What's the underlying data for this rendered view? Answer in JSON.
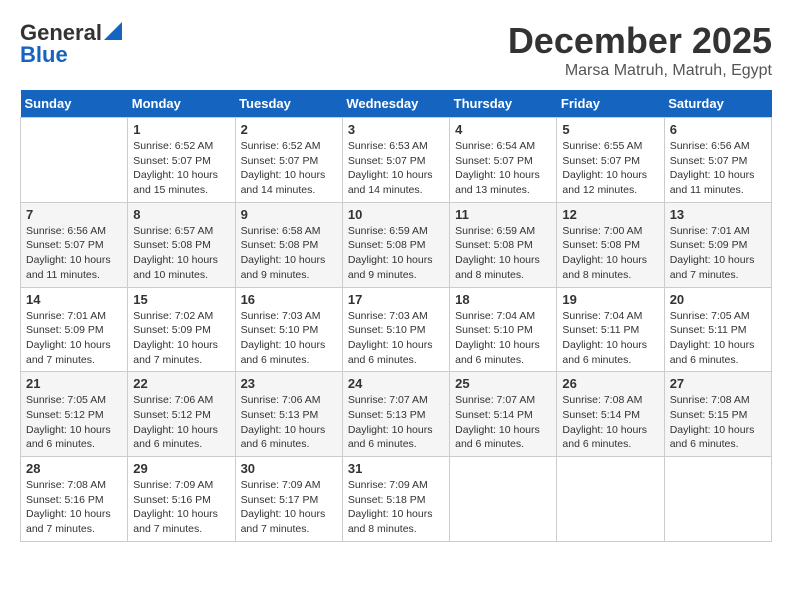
{
  "logo": {
    "line1": "General",
    "line2": "Blue"
  },
  "title": "December 2025",
  "location": "Marsa Matruh, Matruh, Egypt",
  "days_of_week": [
    "Sunday",
    "Monday",
    "Tuesday",
    "Wednesday",
    "Thursday",
    "Friday",
    "Saturday"
  ],
  "weeks": [
    [
      {
        "day": "",
        "text": ""
      },
      {
        "day": "1",
        "text": "Sunrise: 6:52 AM\nSunset: 5:07 PM\nDaylight: 10 hours\nand 15 minutes."
      },
      {
        "day": "2",
        "text": "Sunrise: 6:52 AM\nSunset: 5:07 PM\nDaylight: 10 hours\nand 14 minutes."
      },
      {
        "day": "3",
        "text": "Sunrise: 6:53 AM\nSunset: 5:07 PM\nDaylight: 10 hours\nand 14 minutes."
      },
      {
        "day": "4",
        "text": "Sunrise: 6:54 AM\nSunset: 5:07 PM\nDaylight: 10 hours\nand 13 minutes."
      },
      {
        "day": "5",
        "text": "Sunrise: 6:55 AM\nSunset: 5:07 PM\nDaylight: 10 hours\nand 12 minutes."
      },
      {
        "day": "6",
        "text": "Sunrise: 6:56 AM\nSunset: 5:07 PM\nDaylight: 10 hours\nand 11 minutes."
      }
    ],
    [
      {
        "day": "7",
        "text": "Sunrise: 6:56 AM\nSunset: 5:07 PM\nDaylight: 10 hours\nand 11 minutes."
      },
      {
        "day": "8",
        "text": "Sunrise: 6:57 AM\nSunset: 5:08 PM\nDaylight: 10 hours\nand 10 minutes."
      },
      {
        "day": "9",
        "text": "Sunrise: 6:58 AM\nSunset: 5:08 PM\nDaylight: 10 hours\nand 9 minutes."
      },
      {
        "day": "10",
        "text": "Sunrise: 6:59 AM\nSunset: 5:08 PM\nDaylight: 10 hours\nand 9 minutes."
      },
      {
        "day": "11",
        "text": "Sunrise: 6:59 AM\nSunset: 5:08 PM\nDaylight: 10 hours\nand 8 minutes."
      },
      {
        "day": "12",
        "text": "Sunrise: 7:00 AM\nSunset: 5:08 PM\nDaylight: 10 hours\nand 8 minutes."
      },
      {
        "day": "13",
        "text": "Sunrise: 7:01 AM\nSunset: 5:09 PM\nDaylight: 10 hours\nand 7 minutes."
      }
    ],
    [
      {
        "day": "14",
        "text": "Sunrise: 7:01 AM\nSunset: 5:09 PM\nDaylight: 10 hours\nand 7 minutes."
      },
      {
        "day": "15",
        "text": "Sunrise: 7:02 AM\nSunset: 5:09 PM\nDaylight: 10 hours\nand 7 minutes."
      },
      {
        "day": "16",
        "text": "Sunrise: 7:03 AM\nSunset: 5:10 PM\nDaylight: 10 hours\nand 6 minutes."
      },
      {
        "day": "17",
        "text": "Sunrise: 7:03 AM\nSunset: 5:10 PM\nDaylight: 10 hours\nand 6 minutes."
      },
      {
        "day": "18",
        "text": "Sunrise: 7:04 AM\nSunset: 5:10 PM\nDaylight: 10 hours\nand 6 minutes."
      },
      {
        "day": "19",
        "text": "Sunrise: 7:04 AM\nSunset: 5:11 PM\nDaylight: 10 hours\nand 6 minutes."
      },
      {
        "day": "20",
        "text": "Sunrise: 7:05 AM\nSunset: 5:11 PM\nDaylight: 10 hours\nand 6 minutes."
      }
    ],
    [
      {
        "day": "21",
        "text": "Sunrise: 7:05 AM\nSunset: 5:12 PM\nDaylight: 10 hours\nand 6 minutes."
      },
      {
        "day": "22",
        "text": "Sunrise: 7:06 AM\nSunset: 5:12 PM\nDaylight: 10 hours\nand 6 minutes."
      },
      {
        "day": "23",
        "text": "Sunrise: 7:06 AM\nSunset: 5:13 PM\nDaylight: 10 hours\nand 6 minutes."
      },
      {
        "day": "24",
        "text": "Sunrise: 7:07 AM\nSunset: 5:13 PM\nDaylight: 10 hours\nand 6 minutes."
      },
      {
        "day": "25",
        "text": "Sunrise: 7:07 AM\nSunset: 5:14 PM\nDaylight: 10 hours\nand 6 minutes."
      },
      {
        "day": "26",
        "text": "Sunrise: 7:08 AM\nSunset: 5:14 PM\nDaylight: 10 hours\nand 6 minutes."
      },
      {
        "day": "27",
        "text": "Sunrise: 7:08 AM\nSunset: 5:15 PM\nDaylight: 10 hours\nand 6 minutes."
      }
    ],
    [
      {
        "day": "28",
        "text": "Sunrise: 7:08 AM\nSunset: 5:16 PM\nDaylight: 10 hours\nand 7 minutes."
      },
      {
        "day": "29",
        "text": "Sunrise: 7:09 AM\nSunset: 5:16 PM\nDaylight: 10 hours\nand 7 minutes."
      },
      {
        "day": "30",
        "text": "Sunrise: 7:09 AM\nSunset: 5:17 PM\nDaylight: 10 hours\nand 7 minutes."
      },
      {
        "day": "31",
        "text": "Sunrise: 7:09 AM\nSunset: 5:18 PM\nDaylight: 10 hours\nand 8 minutes."
      },
      {
        "day": "",
        "text": ""
      },
      {
        "day": "",
        "text": ""
      },
      {
        "day": "",
        "text": ""
      }
    ]
  ]
}
